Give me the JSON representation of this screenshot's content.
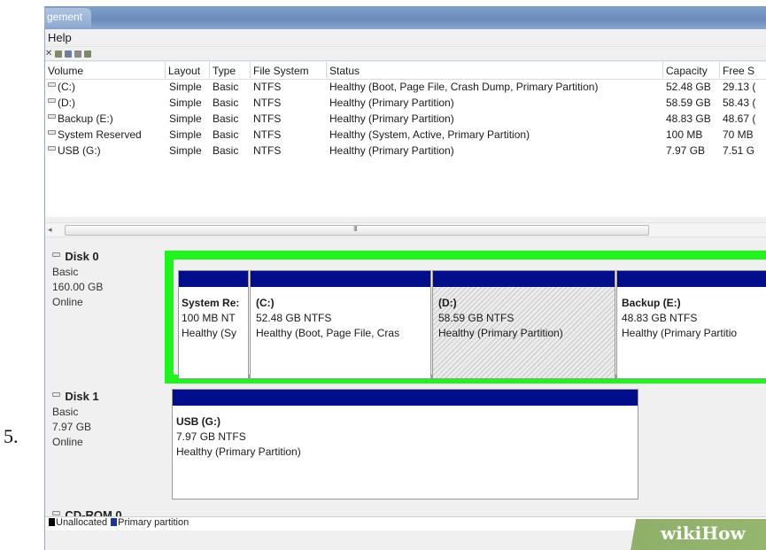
{
  "step_number": "5.",
  "window": {
    "title": "gement"
  },
  "menu": {
    "help": "Help"
  },
  "volume_table": {
    "columns": [
      "Volume",
      "Layout",
      "Type",
      "File System",
      "Status",
      "Capacity",
      "Free S"
    ],
    "rows": [
      [
        "(C:)",
        "Simple",
        "Basic",
        "NTFS",
        "Healthy (Boot, Page File, Crash Dump, Primary Partition)",
        "52.48 GB",
        "29.13 ("
      ],
      [
        "(D:)",
        "Simple",
        "Basic",
        "NTFS",
        "Healthy (Primary Partition)",
        "58.59 GB",
        "58.43 ("
      ],
      [
        "Backup (E:)",
        "Simple",
        "Basic",
        "NTFS",
        "Healthy (Primary Partition)",
        "48.83 GB",
        "48.67 ("
      ],
      [
        "System Reserved",
        "Simple",
        "Basic",
        "NTFS",
        "Healthy (System, Active, Primary Partition)",
        "100 MB",
        "70 MB"
      ],
      [
        "USB (G:)",
        "Simple",
        "Basic",
        "NTFS",
        "Healthy (Primary Partition)",
        "7.97 GB",
        "7.51 G"
      ]
    ]
  },
  "scrollbar": {
    "grip": "III"
  },
  "disks": [
    {
      "name": "Disk 0",
      "type": "Basic",
      "size": "160.00 GB",
      "status": "Online",
      "partitions": [
        {
          "name": "System Re:",
          "size": "100 MB NT",
          "health": "Healthy (Sy"
        },
        {
          "name": "(C:)",
          "size": "52.48 GB NTFS",
          "health": "Healthy (Boot, Page File, Cras"
        },
        {
          "name": "(D:)",
          "size": "58.59 GB NTFS",
          "health": "Healthy (Primary Partition)"
        },
        {
          "name": "Backup  (E:)",
          "size": "48.83 GB NTFS",
          "health": "Healthy (Primary Partitio"
        }
      ]
    },
    {
      "name": "Disk 1",
      "type": "Basic",
      "size": "7.97 GB",
      "status": "Online",
      "partitions": [
        {
          "name": "USB  (G:)",
          "size": "7.97 GB NTFS",
          "health": "Healthy (Primary Partition)"
        }
      ]
    },
    {
      "name": "CD-ROM 0"
    }
  ],
  "legend": {
    "unallocated": "Unallocated",
    "primary": "Primary partition"
  },
  "watermark": {
    "wiki": "wiki",
    "how": "How"
  },
  "colors": {
    "partition_bar": "#000e8c",
    "highlight": "#1ef51a",
    "titlebar": "#6b8dbd"
  }
}
